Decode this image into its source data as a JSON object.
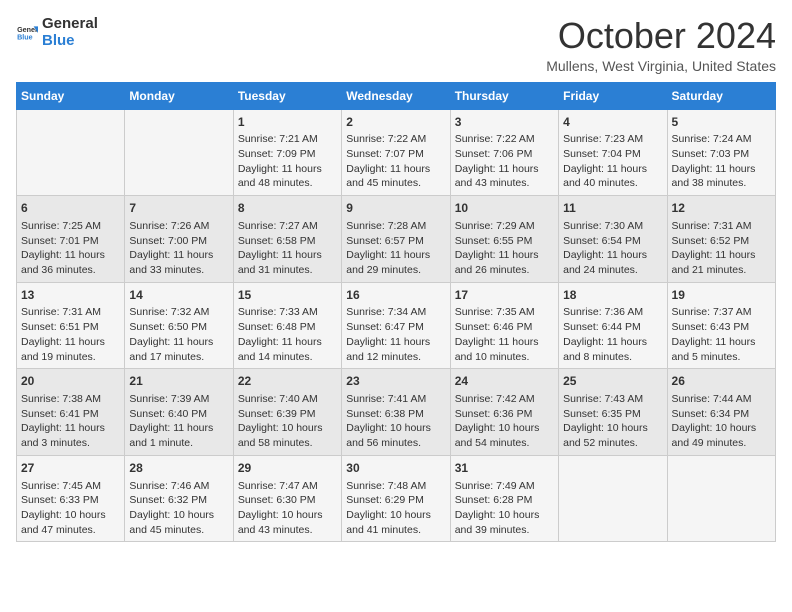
{
  "header": {
    "logo_general": "General",
    "logo_blue": "Blue",
    "title": "October 2024",
    "location": "Mullens, West Virginia, United States"
  },
  "days_of_week": [
    "Sunday",
    "Monday",
    "Tuesday",
    "Wednesday",
    "Thursday",
    "Friday",
    "Saturday"
  ],
  "weeks": [
    [
      {
        "day": "",
        "info": ""
      },
      {
        "day": "",
        "info": ""
      },
      {
        "day": "1",
        "info": "Sunrise: 7:21 AM\nSunset: 7:09 PM\nDaylight: 11 hours and 48 minutes."
      },
      {
        "day": "2",
        "info": "Sunrise: 7:22 AM\nSunset: 7:07 PM\nDaylight: 11 hours and 45 minutes."
      },
      {
        "day": "3",
        "info": "Sunrise: 7:22 AM\nSunset: 7:06 PM\nDaylight: 11 hours and 43 minutes."
      },
      {
        "day": "4",
        "info": "Sunrise: 7:23 AM\nSunset: 7:04 PM\nDaylight: 11 hours and 40 minutes."
      },
      {
        "day": "5",
        "info": "Sunrise: 7:24 AM\nSunset: 7:03 PM\nDaylight: 11 hours and 38 minutes."
      }
    ],
    [
      {
        "day": "6",
        "info": "Sunrise: 7:25 AM\nSunset: 7:01 PM\nDaylight: 11 hours and 36 minutes."
      },
      {
        "day": "7",
        "info": "Sunrise: 7:26 AM\nSunset: 7:00 PM\nDaylight: 11 hours and 33 minutes."
      },
      {
        "day": "8",
        "info": "Sunrise: 7:27 AM\nSunset: 6:58 PM\nDaylight: 11 hours and 31 minutes."
      },
      {
        "day": "9",
        "info": "Sunrise: 7:28 AM\nSunset: 6:57 PM\nDaylight: 11 hours and 29 minutes."
      },
      {
        "day": "10",
        "info": "Sunrise: 7:29 AM\nSunset: 6:55 PM\nDaylight: 11 hours and 26 minutes."
      },
      {
        "day": "11",
        "info": "Sunrise: 7:30 AM\nSunset: 6:54 PM\nDaylight: 11 hours and 24 minutes."
      },
      {
        "day": "12",
        "info": "Sunrise: 7:31 AM\nSunset: 6:52 PM\nDaylight: 11 hours and 21 minutes."
      }
    ],
    [
      {
        "day": "13",
        "info": "Sunrise: 7:31 AM\nSunset: 6:51 PM\nDaylight: 11 hours and 19 minutes."
      },
      {
        "day": "14",
        "info": "Sunrise: 7:32 AM\nSunset: 6:50 PM\nDaylight: 11 hours and 17 minutes."
      },
      {
        "day": "15",
        "info": "Sunrise: 7:33 AM\nSunset: 6:48 PM\nDaylight: 11 hours and 14 minutes."
      },
      {
        "day": "16",
        "info": "Sunrise: 7:34 AM\nSunset: 6:47 PM\nDaylight: 11 hours and 12 minutes."
      },
      {
        "day": "17",
        "info": "Sunrise: 7:35 AM\nSunset: 6:46 PM\nDaylight: 11 hours and 10 minutes."
      },
      {
        "day": "18",
        "info": "Sunrise: 7:36 AM\nSunset: 6:44 PM\nDaylight: 11 hours and 8 minutes."
      },
      {
        "day": "19",
        "info": "Sunrise: 7:37 AM\nSunset: 6:43 PM\nDaylight: 11 hours and 5 minutes."
      }
    ],
    [
      {
        "day": "20",
        "info": "Sunrise: 7:38 AM\nSunset: 6:41 PM\nDaylight: 11 hours and 3 minutes."
      },
      {
        "day": "21",
        "info": "Sunrise: 7:39 AM\nSunset: 6:40 PM\nDaylight: 11 hours and 1 minute."
      },
      {
        "day": "22",
        "info": "Sunrise: 7:40 AM\nSunset: 6:39 PM\nDaylight: 10 hours and 58 minutes."
      },
      {
        "day": "23",
        "info": "Sunrise: 7:41 AM\nSunset: 6:38 PM\nDaylight: 10 hours and 56 minutes."
      },
      {
        "day": "24",
        "info": "Sunrise: 7:42 AM\nSunset: 6:36 PM\nDaylight: 10 hours and 54 minutes."
      },
      {
        "day": "25",
        "info": "Sunrise: 7:43 AM\nSunset: 6:35 PM\nDaylight: 10 hours and 52 minutes."
      },
      {
        "day": "26",
        "info": "Sunrise: 7:44 AM\nSunset: 6:34 PM\nDaylight: 10 hours and 49 minutes."
      }
    ],
    [
      {
        "day": "27",
        "info": "Sunrise: 7:45 AM\nSunset: 6:33 PM\nDaylight: 10 hours and 47 minutes."
      },
      {
        "day": "28",
        "info": "Sunrise: 7:46 AM\nSunset: 6:32 PM\nDaylight: 10 hours and 45 minutes."
      },
      {
        "day": "29",
        "info": "Sunrise: 7:47 AM\nSunset: 6:30 PM\nDaylight: 10 hours and 43 minutes."
      },
      {
        "day": "30",
        "info": "Sunrise: 7:48 AM\nSunset: 6:29 PM\nDaylight: 10 hours and 41 minutes."
      },
      {
        "day": "31",
        "info": "Sunrise: 7:49 AM\nSunset: 6:28 PM\nDaylight: 10 hours and 39 minutes."
      },
      {
        "day": "",
        "info": ""
      },
      {
        "day": "",
        "info": ""
      }
    ]
  ]
}
